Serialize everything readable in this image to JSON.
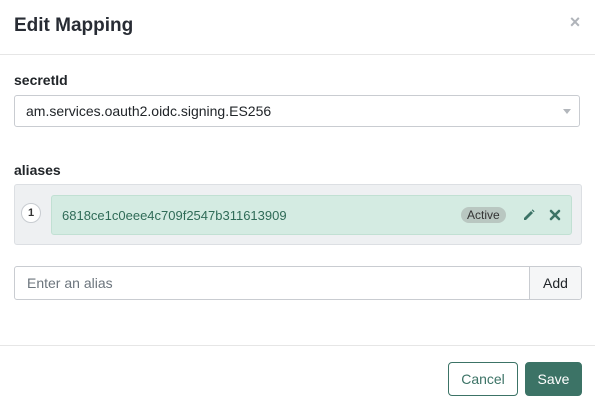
{
  "dialog": {
    "title": "Edit Mapping",
    "close_label": "×"
  },
  "secret_id": {
    "label": "secretId",
    "value": "am.services.oauth2.oidc.signing.ES256"
  },
  "aliases": {
    "label": "aliases",
    "items": [
      {
        "index": "1",
        "value": "6818ce1c0eee4c709f2547b311613909",
        "status": "Active"
      }
    ]
  },
  "alias_input": {
    "placeholder": "Enter an alias",
    "value": "",
    "add_label": "Add"
  },
  "footer": {
    "cancel_label": "Cancel",
    "save_label": "Save"
  },
  "colors": {
    "primary": "#3c7366",
    "alias_bg": "#d4ebe2",
    "alias_text": "#2f6b57",
    "badge_bg": "#b9c7c1"
  },
  "icons": {
    "close": "close-icon",
    "caret": "chevron-down-icon",
    "edit": "pencil-icon",
    "remove": "remove-icon"
  }
}
